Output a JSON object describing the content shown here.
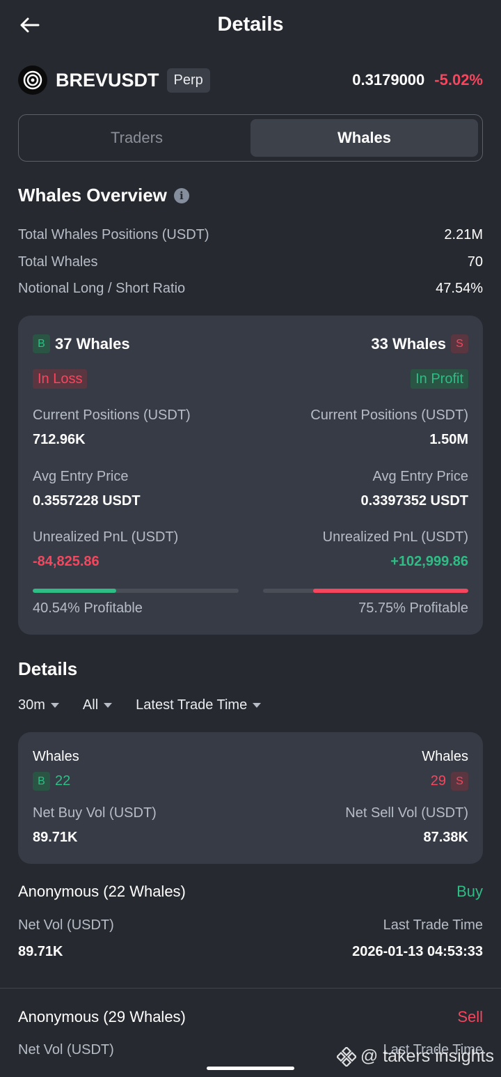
{
  "header": {
    "title": "Details"
  },
  "pair": {
    "symbol": "BREVUSDT",
    "type_badge": "Perp",
    "price": "0.3179000",
    "change": "-5.02%"
  },
  "tabs": [
    {
      "label": "Traders",
      "active": false
    },
    {
      "label": "Whales",
      "active": true
    }
  ],
  "overview": {
    "title": "Whales Overview",
    "rows": [
      {
        "label": "Total Whales Positions (USDT)",
        "value": "2.21M"
      },
      {
        "label": "Total Whales",
        "value": "70"
      },
      {
        "label": "Notional Long / Short Ratio",
        "value": "47.54%"
      }
    ]
  },
  "summary_card": {
    "long": {
      "badge": "B",
      "count": "37 Whales",
      "status": "In Loss",
      "positions_label": "Current Positions (USDT)",
      "positions_value": "712.96K",
      "entry_label": "Avg Entry Price",
      "entry_value": "0.3557228 USDT",
      "pnl_label": "Unrealized PnL (USDT)",
      "pnl_value": "-84,825.86",
      "profitable": "40.54% Profitable",
      "profitable_fraction": 0.4054
    },
    "short": {
      "badge": "S",
      "count": "33 Whales",
      "status": "In Profit",
      "positions_label": "Current Positions (USDT)",
      "positions_value": "1.50M",
      "entry_label": "Avg Entry Price",
      "entry_value": "0.3397352 USDT",
      "pnl_label": "Unrealized PnL (USDT)",
      "pnl_value": "+102,999.86",
      "profitable": "75.75% Profitable",
      "profitable_fraction": 0.7575
    }
  },
  "details": {
    "title": "Details",
    "filters": [
      {
        "label": "30m"
      },
      {
        "label": "All"
      },
      {
        "label": "Latest Trade Time"
      }
    ],
    "vol_card": {
      "buy": {
        "label": "Whales",
        "badge": "B",
        "count": "22",
        "vol_label": "Net Buy Vol (USDT)",
        "vol_value": "89.71K"
      },
      "sell": {
        "label": "Whales",
        "badge": "S",
        "count": "29",
        "vol_label": "Net Sell Vol (USDT)",
        "vol_value": "87.38K"
      }
    },
    "entries": [
      {
        "name": "Anonymous (22 Whales)",
        "side": "Buy",
        "vol_label": "Net Vol (USDT)",
        "vol_value": "89.71K",
        "time_label": "Last Trade Time",
        "time_value": "2026-01-13 04:53:33"
      },
      {
        "name": "Anonymous (29 Whales)",
        "side": "Sell",
        "vol_label": "Net Vol (USDT)",
        "time_label": "Last Trade Time"
      }
    ]
  },
  "watermark": "@ takers insights",
  "colors": {
    "background": "#262930",
    "card": "#373b45",
    "buy": "#2ebd85",
    "sell": "#f6465d"
  }
}
